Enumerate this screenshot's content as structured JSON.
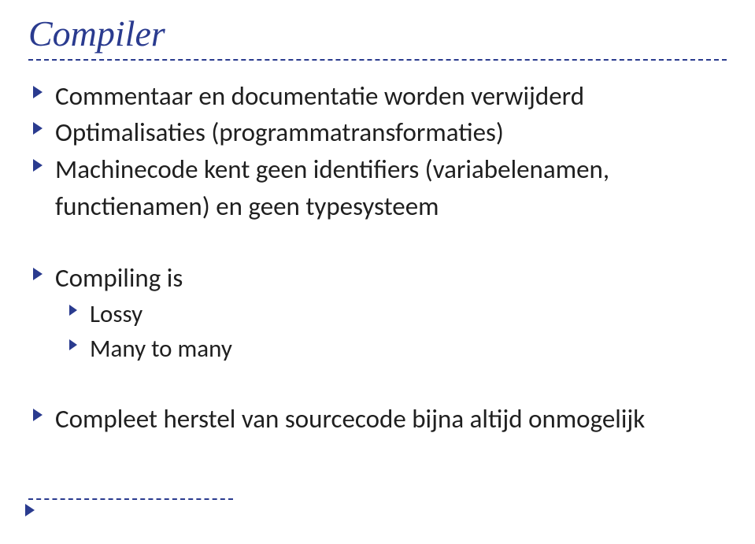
{
  "title": "Compiler",
  "bullets": {
    "b1": "Commentaar en documentatie worden verwijderd",
    "b2": "Optimalisaties (programmatransformaties)",
    "b3": "Machinecode kent geen identifiers (variabelenamen, functienamen) en geen typesysteem",
    "b4": "Compiling is",
    "b4a": "Lossy",
    "b4b": "Many to many",
    "b5": "Compleet herstel van sourcecode bijna altijd onmogelijk"
  },
  "colors": {
    "accent": "#2a3b8f"
  }
}
